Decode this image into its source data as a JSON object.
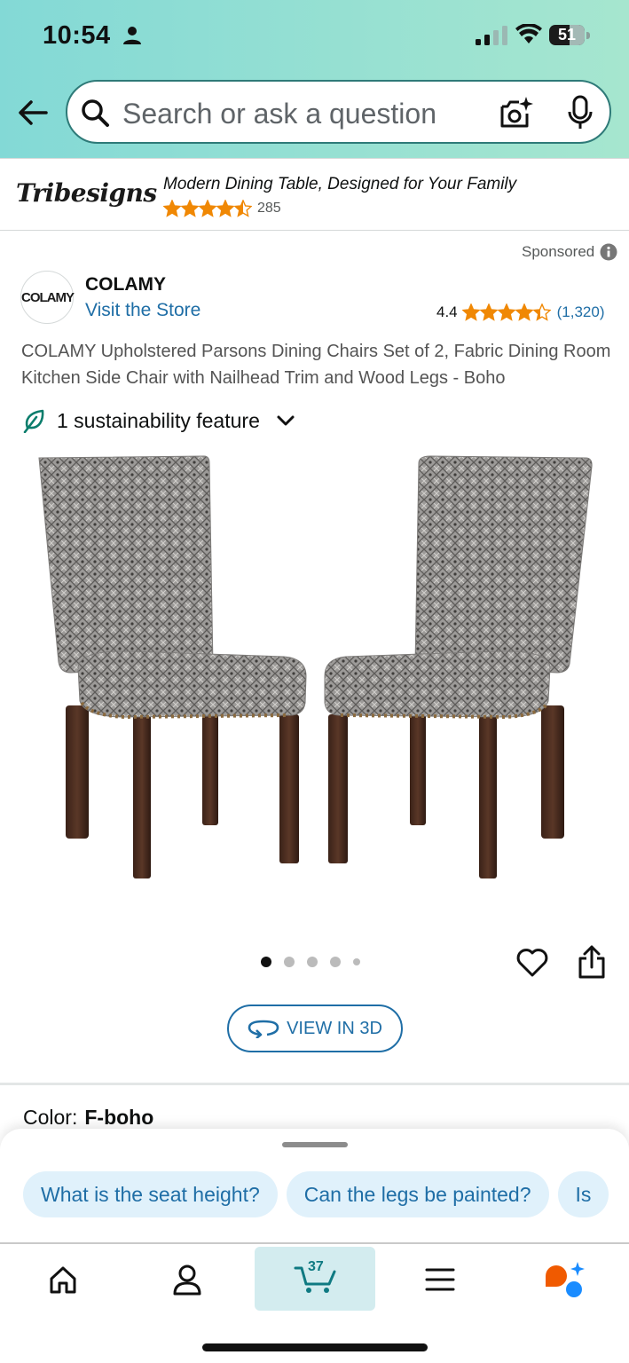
{
  "status_bar": {
    "time": "10:54",
    "battery": "51"
  },
  "search": {
    "placeholder": "Search or ask a question"
  },
  "banner": {
    "logo_text": "Tribesigns",
    "headline": "Modern Dining Table, Designed for Your Family",
    "rating_stars": 4.5,
    "review_count": "285"
  },
  "product": {
    "sponsored_label": "Sponsored",
    "brand_logo_text": "COLAMY",
    "brand_name": "COLAMY",
    "visit_store_label": "Visit the Store",
    "rating_value": "4.4",
    "rating_stars": 4.4,
    "rating_count": "(1,320)",
    "title": "COLAMY Upholstered Parsons Dining Chairs Set of 2, Fabric Dining Room Kitchen Side Chair with Nailhead Trim and Wood Legs - Boho",
    "sustainability_label": "1 sustainability feature",
    "image_count": 5,
    "active_image_index": 0,
    "view_3d_label": "VIEW IN 3D",
    "color_label": "Color:",
    "color_value": "F-boho"
  },
  "rufus": {
    "chips": [
      "What is the seat height?",
      "Can the legs be painted?",
      "Is"
    ]
  },
  "bottom_nav": {
    "cart_count": "37",
    "active_tab": "cart"
  },
  "colors": {
    "header_teal": "#83d9d6",
    "link_blue": "#1f6ea6",
    "star_orange": "#f08804",
    "chip_bg": "#e0f1fb",
    "cart_tab_bg": "#d3ecef"
  }
}
